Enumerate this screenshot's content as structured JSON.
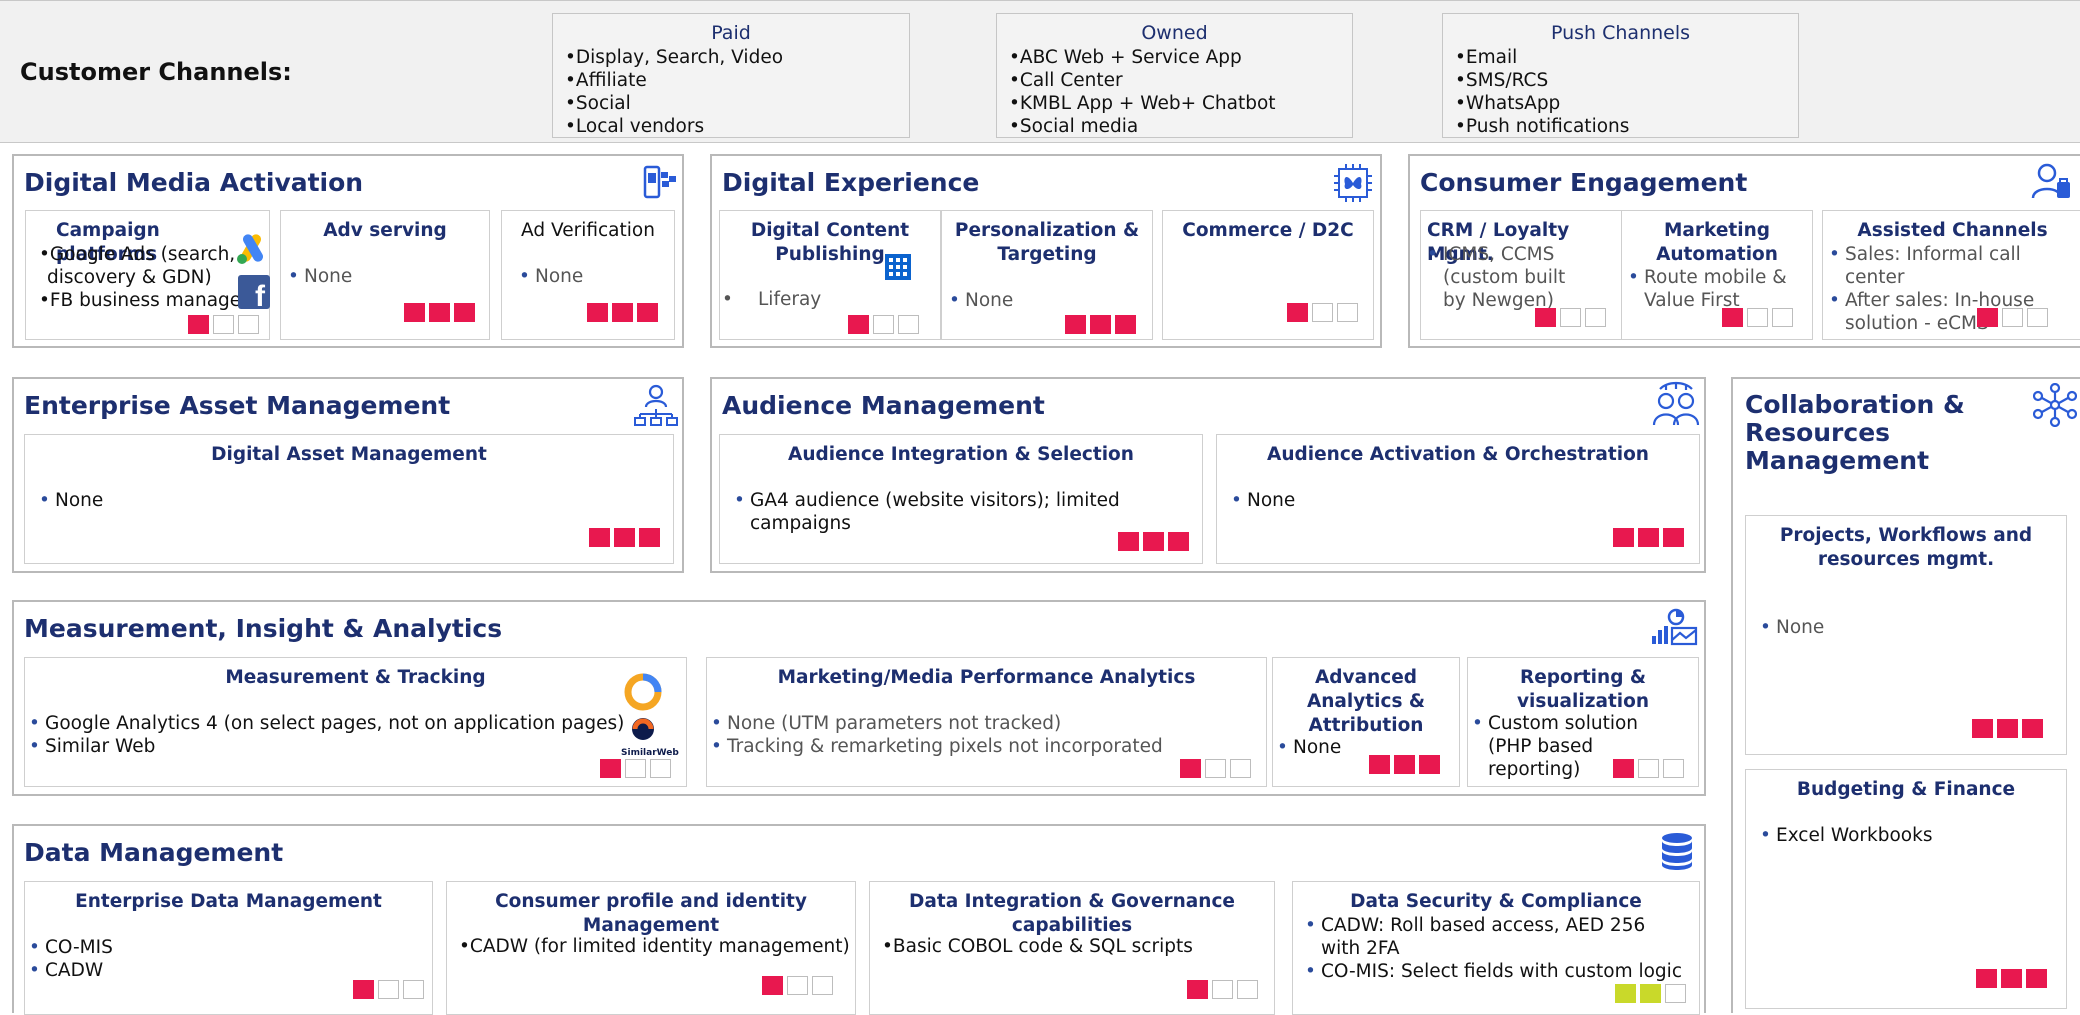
{
  "header": {
    "label": "Customer Channels:",
    "paid": {
      "title": "Paid",
      "items": [
        "•Display, Search, Video",
        "•Affiliate",
        "•Social",
        "•Local vendors"
      ]
    },
    "owned": {
      "title": "Owned",
      "items": [
        "•ABC Web + Service App",
        "•Call Center",
        "•KMBL App + Web+ Chatbot",
        "•Social media"
      ]
    },
    "push": {
      "title": "Push Channels",
      "items": [
        "•Email",
        "•SMS/RCS",
        "•WhatsApp",
        "•Push notifications"
      ]
    }
  },
  "colors": {
    "accent": "#1d2f6f",
    "filled": "#e8184f",
    "partial": "#c9d92a"
  },
  "sections": {
    "dma": {
      "title": "Digital Media Activation",
      "icon": "mobile-ads-icon",
      "campaign": {
        "title": "Campaign platforms",
        "items": [
          "•Google Ads (search,",
          "discovery & GDN)",
          "•FB business manager"
        ],
        "maturity": 1
      },
      "adserving": {
        "title": "Adv serving",
        "items": [
          "None"
        ],
        "maturity": 3
      },
      "adverif": {
        "title": "Ad Verification",
        "items": [
          "None"
        ],
        "maturity": 3
      }
    },
    "dx": {
      "title": "Digital Experience",
      "icon": "butterfly-chip-icon",
      "dcp": {
        "title": "Digital Content Publishing",
        "items": [
          "Liferay"
        ],
        "maturity": 1
      },
      "pers": {
        "title": "Personalization & Targeting",
        "items": [
          "None"
        ],
        "maturity": 3
      },
      "commerce": {
        "title": "Commerce / D2C",
        "maturity": 1
      }
    },
    "ce": {
      "title": "Consumer Engagement",
      "icon": "user-bag-icon",
      "crm": {
        "title": "CRM / Loyalty Mgmt.",
        "items": [
          "ICMS, CCMS (custom built by Newgen)"
        ],
        "maturity": 1
      },
      "ma": {
        "title": "Marketing Automation",
        "items": [
          "Route mobile & Value First"
        ],
        "maturity": 1
      },
      "ac": {
        "title": "Assisted Channels",
        "items": [
          "Sales: Informal call center",
          "After sales: In-house solution - eCMS"
        ],
        "maturity": 1
      }
    },
    "eam": {
      "title": "Enterprise Asset Management",
      "icon": "org-chart-icon",
      "dam": {
        "title": "Digital Asset Management",
        "items": [
          "None"
        ],
        "maturity": 3
      }
    },
    "am": {
      "title": "Audience Management",
      "icon": "audience-group-icon",
      "ais": {
        "title": "Audience Integration & Selection",
        "items": [
          "GA4 audience (website visitors); limited campaigns"
        ],
        "maturity": 3
      },
      "aao": {
        "title": "Audience Activation & Orchestration",
        "items": [
          "None"
        ],
        "maturity": 3
      }
    },
    "collab": {
      "title": "Collaboration & Resources Management",
      "icon": "network-nodes-icon",
      "pwr": {
        "title": "Projects, Workflows and resources mgmt.",
        "items": [
          "None"
        ],
        "maturity": 3
      },
      "bf": {
        "title": "Budgeting & Finance",
        "items": [
          "Excel Workbooks"
        ],
        "maturity": 3
      }
    },
    "mia": {
      "title": "Measurement, Insight & Analytics",
      "icon": "analytics-chart-icon",
      "mt": {
        "title": "Measurement & Tracking",
        "items": [
          "Google Analytics 4 (on select pages, not on application pages)",
          "Similar Web"
        ],
        "maturity": 1,
        "logo_text": "SimilarWeb"
      },
      "mmpa": {
        "title": "Marketing/Media Performance Analytics",
        "items": [
          "None (UTM parameters not tracked)",
          "Tracking & remarketing pixels not incorporated"
        ],
        "maturity": 1
      },
      "aa": {
        "title": "Advanced Analytics & Attribution",
        "items": [
          "None"
        ],
        "maturity": 3
      },
      "rv": {
        "title": "Reporting & visualization",
        "items": [
          "Custom solution (PHP based reporting)"
        ],
        "maturity": 1
      }
    },
    "dm": {
      "title": "Data Management",
      "icon": "database-icon",
      "edm": {
        "title": "Enterprise Data Management",
        "items": [
          "CO-MIS",
          "CADW"
        ],
        "maturity": 1
      },
      "cpim": {
        "title": "Consumer profile and identity Management",
        "items": [
          "•CADW (for limited identity management)"
        ],
        "maturity": 1
      },
      "dig": {
        "title": "Data Integration & Governance capabilities",
        "items": [
          "•Basic COBOL code & SQL scripts"
        ],
        "maturity": 1
      },
      "dsc": {
        "title": "Data Security & Compliance",
        "items": [
          "CADW: Roll based access, AED 256 with 2FA",
          "CO-MIS: Select fields with custom logic"
        ],
        "maturity": 2
      }
    }
  }
}
